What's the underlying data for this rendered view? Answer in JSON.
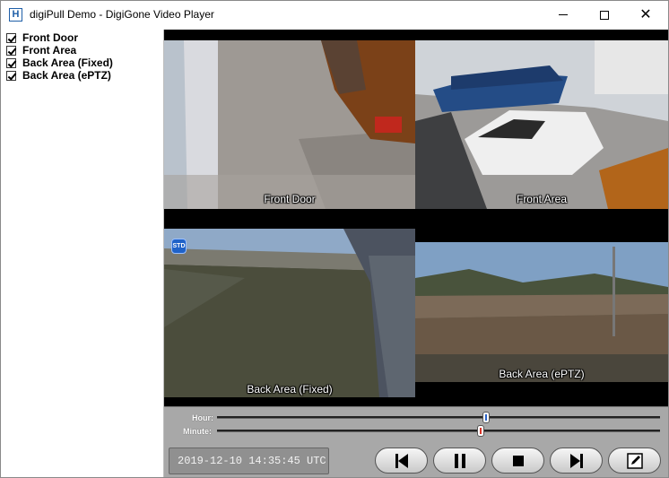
{
  "window": {
    "title": "digiPull Demo - DigiGone Video Player",
    "app_icon_letter": "H"
  },
  "sidebar": {
    "items": [
      {
        "label": "Front Door",
        "checked": true
      },
      {
        "label": "Front Area",
        "checked": true
      },
      {
        "label": "Back Area (Fixed)",
        "checked": true
      },
      {
        "label": "Back Area (ePTZ)",
        "checked": true
      }
    ]
  },
  "video": {
    "tiles": [
      {
        "label": "Front Door"
      },
      {
        "label": "Front Area"
      },
      {
        "label": "Back Area (Fixed)",
        "badge": "STD"
      },
      {
        "label": "Back Area (ePTZ)"
      }
    ]
  },
  "controls": {
    "hour_label": "Hour:",
    "minute_label": "Minute:",
    "hour_position": 0.6,
    "minute_position": 0.59,
    "hour_thumb_color": "#2b63c8",
    "minute_thumb_color": "#d9352a",
    "timestamp": "2019-12-10 14:35:45 UTC",
    "buttons": [
      "skip-back",
      "pause",
      "stop",
      "skip-forward",
      "edit"
    ]
  }
}
